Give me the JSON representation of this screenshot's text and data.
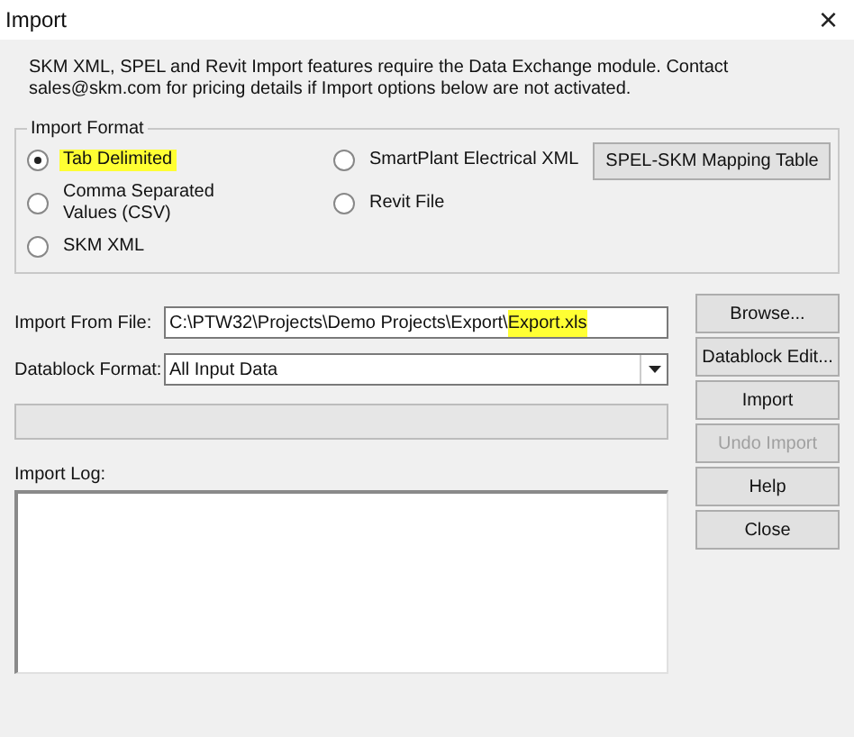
{
  "window": {
    "title": "Import",
    "close": "×"
  },
  "notice": "SKM XML, SPEL and Revit Import features require the Data Exchange module.  Contact sales@skm.com for pricing details if Import options below are not activated.",
  "import_format": {
    "legend": "Import Format",
    "rows": [
      [
        {
          "label": "Tab Delimited",
          "selected": true,
          "highlighted": true
        },
        {
          "label": "SmartPlant Electrical XML",
          "selected": false,
          "highlighted": false
        }
      ],
      [
        {
          "label": "Comma Separated Values (CSV)",
          "selected": false,
          "highlighted": false
        },
        {
          "label": "Revit File",
          "selected": false,
          "highlighted": false
        }
      ],
      [
        {
          "label": "SKM XML",
          "selected": false,
          "highlighted": false
        }
      ]
    ],
    "mapping_button": "SPEL-SKM Mapping Table"
  },
  "import_file": {
    "label": "Import From File:",
    "value_parts": [
      {
        "text": "C:\\PTW32\\Projects\\Demo Projects\\Export\\",
        "highlighted": false
      },
      {
        "text": "Export.xls",
        "highlighted": true
      }
    ]
  },
  "datablock_format": {
    "label": "Datablock Format:",
    "value": "All Input Data"
  },
  "progress": {
    "level": 0
  },
  "import_log": {
    "label": "Import Log:"
  },
  "buttons": [
    {
      "label": "Browse...",
      "disabled": false
    },
    {
      "label": "Datablock Edit...",
      "disabled": false
    },
    {
      "label": "Import",
      "disabled": false
    },
    {
      "label": "Undo Import",
      "disabled": true
    },
    {
      "label": "Help",
      "disabled": false
    },
    {
      "label": "Close",
      "disabled": false
    }
  ]
}
